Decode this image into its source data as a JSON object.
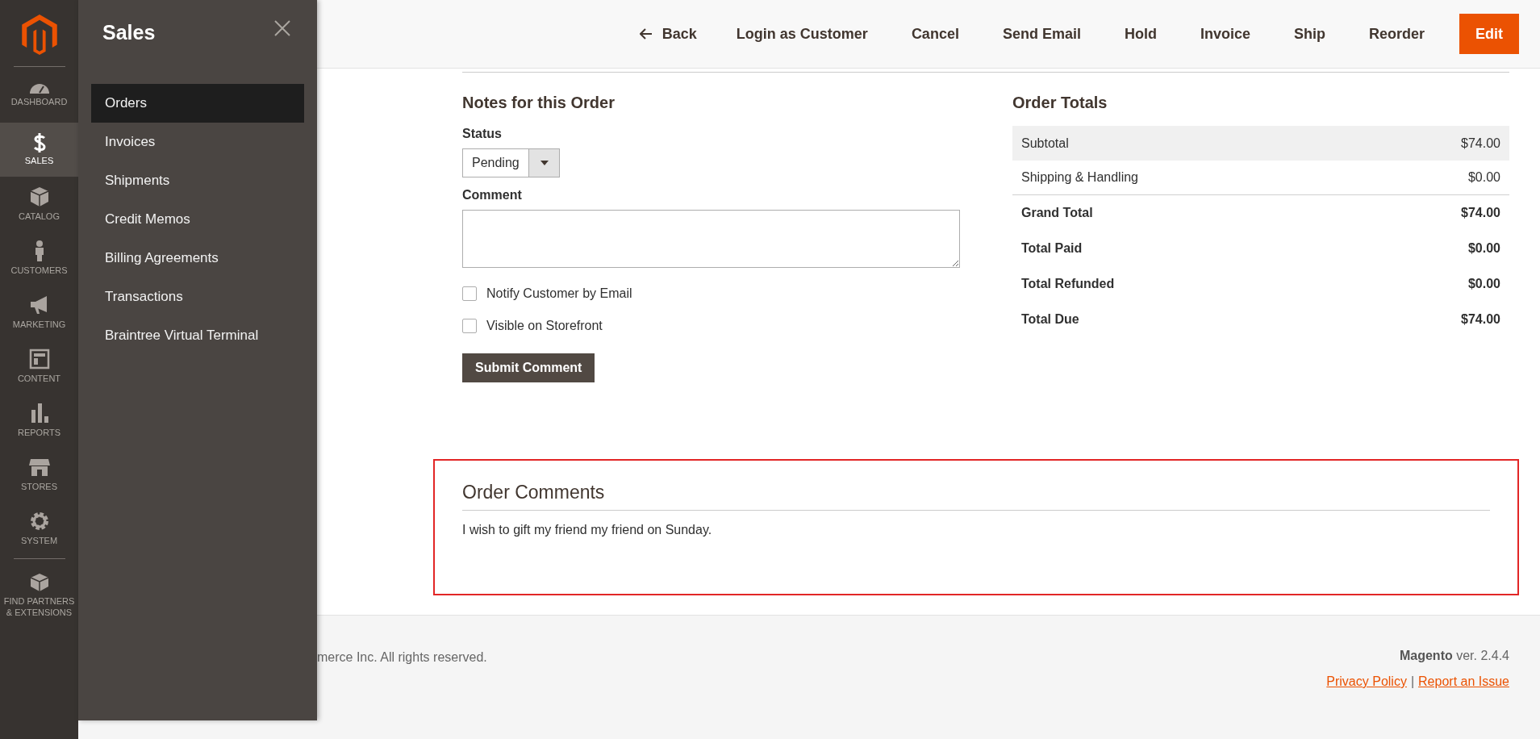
{
  "nav": {
    "items": [
      {
        "label": "DASHBOARD",
        "kind": "dashboard",
        "selected": false
      },
      {
        "label": "SALES",
        "kind": "sales",
        "selected": true
      },
      {
        "label": "CATALOG",
        "kind": "catalog",
        "selected": false
      },
      {
        "label": "CUSTOMERS",
        "kind": "customers",
        "selected": false
      },
      {
        "label": "MARKETING",
        "kind": "marketing",
        "selected": false
      },
      {
        "label": "CONTENT",
        "kind": "content",
        "selected": false
      },
      {
        "label": "REPORTS",
        "kind": "reports",
        "selected": false
      },
      {
        "label": "STORES",
        "kind": "stores",
        "selected": false
      },
      {
        "label": "SYSTEM",
        "kind": "system",
        "selected": false
      },
      {
        "label": "FIND PARTNERS & EXTENSIONS",
        "kind": "partners",
        "selected": false
      }
    ]
  },
  "flyout": {
    "title": "Sales",
    "items": [
      {
        "label": "Orders",
        "selected": true
      },
      {
        "label": "Invoices",
        "selected": false
      },
      {
        "label": "Shipments",
        "selected": false
      },
      {
        "label": "Credit Memos",
        "selected": false
      },
      {
        "label": "Billing Agreements",
        "selected": false
      },
      {
        "label": "Transactions",
        "selected": false
      },
      {
        "label": "Braintree Virtual Terminal",
        "selected": false
      }
    ]
  },
  "header": {
    "back": "Back",
    "buttons": [
      {
        "label": "Login as Customer",
        "kind": "plain"
      },
      {
        "label": "Cancel",
        "kind": "plain"
      },
      {
        "label": "Send Email",
        "kind": "plain"
      },
      {
        "label": "Hold",
        "kind": "plain"
      },
      {
        "label": "Invoice",
        "kind": "plain"
      },
      {
        "label": "Ship",
        "kind": "plain"
      },
      {
        "label": "Reorder",
        "kind": "plain"
      },
      {
        "label": "Edit",
        "kind": "primary"
      }
    ]
  },
  "notes": {
    "title": "Notes for this Order",
    "status_label": "Status",
    "status_value": "Pending",
    "comment_label": "Comment",
    "checkboxes": [
      {
        "label": "Notify Customer by Email",
        "checked": false
      },
      {
        "label": "Visible on Storefront",
        "checked": false
      }
    ],
    "submit": "Submit Comment"
  },
  "totals": {
    "title": "Order Totals",
    "rows": [
      {
        "label": "Subtotal",
        "value": "$74.00",
        "kind": "shaded"
      },
      {
        "label": "Shipping & Handling",
        "value": "$0.00",
        "kind": "plain"
      },
      {
        "label": "Grand Total",
        "value": "$74.00",
        "kind": "bold"
      },
      {
        "label": "Total Paid",
        "value": "$0.00",
        "kind": "bold"
      },
      {
        "label": "Total Refunded",
        "value": "$0.00",
        "kind": "bold"
      },
      {
        "label": "Total Due",
        "value": "$74.00",
        "kind": "bold"
      }
    ]
  },
  "order_comments": {
    "title": "Order Comments",
    "text": "I wish to gift my friend my friend on Sunday."
  },
  "footer": {
    "copyright": "merce Inc. All rights reserved.",
    "brand": "Magento",
    "version": "ver. 2.4.4",
    "links": [
      "Privacy Policy",
      "Report an Issue"
    ],
    "separator": "|"
  }
}
